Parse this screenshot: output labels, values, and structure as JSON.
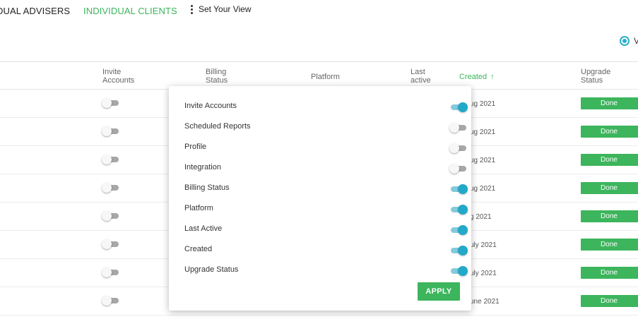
{
  "tabs": {
    "advisers": "DUAL ADVISERS",
    "clients": "INDIVIDUAL CLIENTS",
    "set_view": "Set Your View"
  },
  "radio": {
    "label": "V"
  },
  "columns": {
    "invite": "Invite Accounts",
    "billing": "Billing Status",
    "platform": "Platform",
    "last_active": "Last active",
    "created": "Created",
    "upgrade": "Upgrade Status"
  },
  "rows": [
    {
      "date": "ug 2021",
      "status": "Done",
      "invite_on": false
    },
    {
      "date": "ug 2021",
      "status": "Done",
      "invite_on": false
    },
    {
      "date": "ug 2021",
      "status": "Done",
      "invite_on": false
    },
    {
      "date": "ug 2021",
      "status": "Done",
      "invite_on": false
    },
    {
      "date": "g 2021",
      "status": "Done",
      "invite_on": false
    },
    {
      "date": "uly 2021",
      "status": "Done",
      "invite_on": false
    },
    {
      "date": "uly 2021",
      "status": "Done",
      "invite_on": false
    },
    {
      "date": "une 2021",
      "status": "Done",
      "invite_on": false
    }
  ],
  "popup": {
    "options": [
      {
        "label": "Invite Accounts",
        "on": true
      },
      {
        "label": "Scheduled Reports",
        "on": false
      },
      {
        "label": "Profile",
        "on": false
      },
      {
        "label": "Integration",
        "on": false
      },
      {
        "label": "Billing Status",
        "on": true
      },
      {
        "label": "Platform",
        "on": true
      },
      {
        "label": "Last Active",
        "on": true
      },
      {
        "label": "Created",
        "on": true
      },
      {
        "label": "Upgrade Status",
        "on": true
      }
    ],
    "apply_label": "APPLY"
  },
  "colors": {
    "accent_green": "#3cb55c",
    "toggle_blue": "#22a8c8"
  }
}
